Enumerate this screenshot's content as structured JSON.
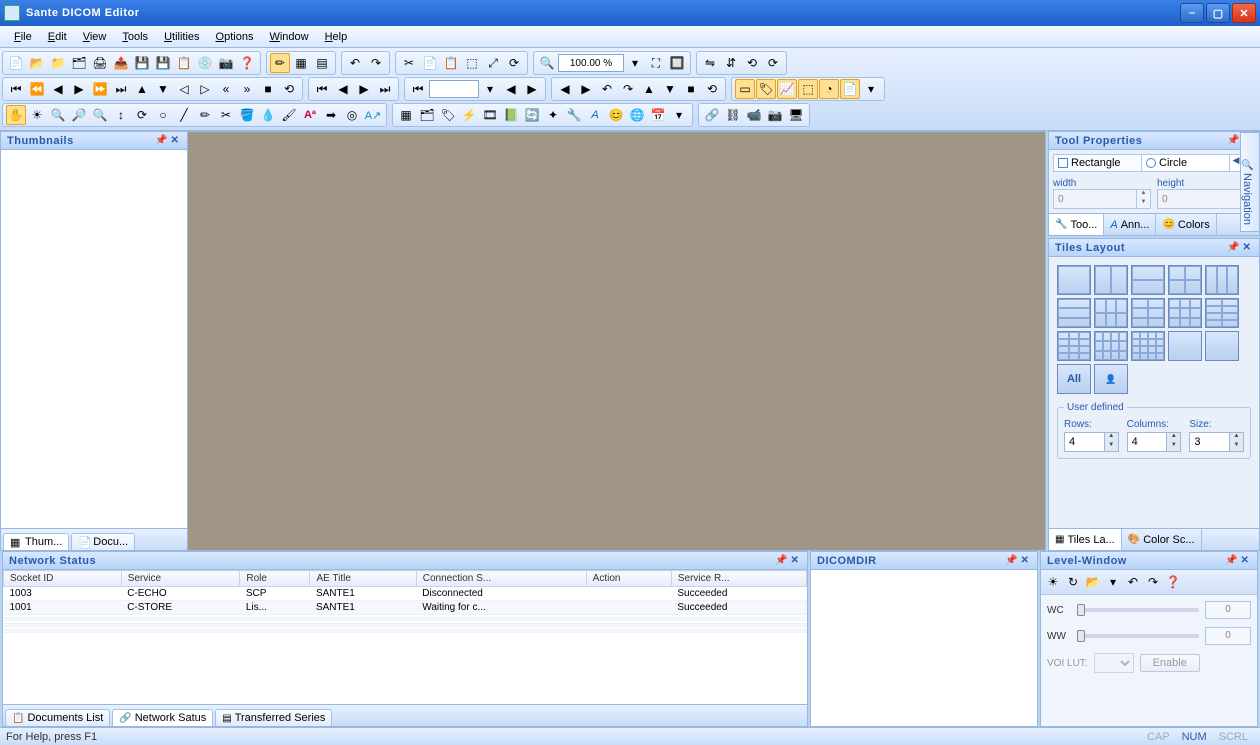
{
  "app": {
    "title": "Sante DICOM Editor"
  },
  "menu": [
    "File",
    "Edit",
    "View",
    "Tools",
    "Utilities",
    "Options",
    "Window",
    "Help"
  ],
  "zoom": "100.00 %",
  "thumbnails": {
    "title": "Thumbnails",
    "tabs": [
      "Thum...",
      "Docu..."
    ]
  },
  "toolProps": {
    "title": "Tool Properties",
    "shapeTabs": [
      "Rectangle",
      "Circle"
    ],
    "widthLabel": "width",
    "heightLabel": "height",
    "widthVal": "0",
    "heightVal": "0",
    "bottomTabs": [
      "Too...",
      "Ann...",
      "Colors"
    ]
  },
  "tilesLayout": {
    "title": "Tiles Layout",
    "userDefined": "User defined",
    "rowsLabel": "Rows:",
    "colsLabel": "Columns:",
    "sizeLabel": "Size:",
    "rows": "4",
    "cols": "4",
    "size": "3",
    "allLabel": "All",
    "bottomTabs": [
      "Tiles La...",
      "Color Sc..."
    ]
  },
  "navTab": "Navigation",
  "network": {
    "title": "Network Status",
    "headers": [
      "Socket ID",
      "Service",
      "Role",
      "AE Title",
      "Connection S...",
      "Action",
      "Service R..."
    ],
    "rows": [
      {
        "socket": "1003",
        "service": "C-ECHO",
        "role": "SCP",
        "ae": "SANTE1",
        "conn": "Disconnected",
        "action": "",
        "result": "Succeeded"
      },
      {
        "socket": "1001",
        "service": "C-STORE",
        "role": "Lis...",
        "ae": "SANTE1",
        "conn": "Waiting for c...",
        "action": "",
        "result": "Succeeded"
      }
    ],
    "bottomTabs": [
      "Documents List",
      "Network Satus",
      "Transferred Series"
    ]
  },
  "dicomdir": {
    "title": "DICOMDIR"
  },
  "levelWindow": {
    "title": "Level-Window",
    "wcLabel": "WC",
    "wwLabel": "WW",
    "wcVal": "0",
    "wwVal": "0",
    "voiLabel": "VOI LUT:",
    "enableLabel": "Enable"
  },
  "status": {
    "help": "For Help, press F1",
    "cap": "CAP",
    "num": "NUM",
    "scrl": "SCRL"
  }
}
